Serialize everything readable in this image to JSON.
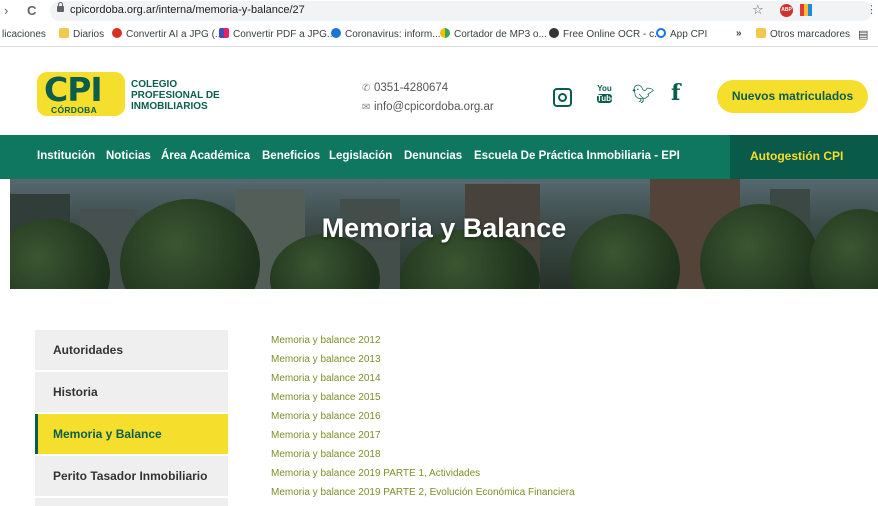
{
  "browser": {
    "url": "cpicordoba.org.ar/interna/memoria-y-balance/27",
    "bookmarks": [
      {
        "label": "licaciones",
        "icon": "none"
      },
      {
        "label": "Diarios",
        "icon": "folder"
      },
      {
        "label": "Convertir AI a JPG (...",
        "icon": "red-circle"
      },
      {
        "label": "Convertir PDF a JPG...",
        "icon": "grid"
      },
      {
        "label": "Coronavirus: inform...",
        "icon": "blue-drop"
      },
      {
        "label": "Cortador de MP3 o...",
        "icon": "multi-dot"
      },
      {
        "label": "Free Online OCR - c...",
        "icon": "dark-circle"
      },
      {
        "label": "App CPI",
        "icon": "ring"
      },
      {
        "label": "Otros marcadores",
        "icon": "folder"
      }
    ],
    "bookmarks_overflow": "»"
  },
  "header": {
    "logo_main": "CPI",
    "logo_city": "CÓRDOBA",
    "org_name_lines": [
      "COLEGIO",
      "PROFESIONAL DE",
      "INMOBILIARIOS"
    ],
    "phone": "0351-4280674",
    "email": "info@cpicordoba.org.ar",
    "cta_label": "Nuevos matriculados",
    "social_icons": [
      "instagram-icon",
      "youtube-icon",
      "twitter-icon",
      "facebook-icon"
    ],
    "youtube_you": "You",
    "youtube_tube": "Tube"
  },
  "nav": {
    "items": [
      "Institución",
      "Noticias",
      "Área Académica",
      "Beneficios",
      "Legislación",
      "Denuncias",
      "Escuela De Práctica Inmobiliaria - EPI"
    ],
    "autogestion": "Autogestión CPI"
  },
  "hero": {
    "title": "Memoria y Balance"
  },
  "sidebar": {
    "items": [
      {
        "label": "Autoridades",
        "active": false
      },
      {
        "label": "Historia",
        "active": false
      },
      {
        "label": "Memoria y Balance",
        "active": true
      },
      {
        "label": "Perito Tasador Inmobiliario",
        "active": false
      }
    ]
  },
  "documents": [
    "Memoria y balance 2012",
    "Memoria y balance 2013",
    "Memoria y balance 2014",
    "Memoria y balance 2015",
    "Memoria y balance 2016",
    "Memoria y balance 2017",
    "Memoria y balance 2018",
    "Memoria y balance 2019 PARTE 1, Actividades",
    "Memoria y balance 2019 PARTE 2, Evolución Económica Financiera"
  ],
  "colors": {
    "brand_green": "#0f7660",
    "brand_dark_green": "#0b5d4e",
    "brand_yellow": "#f5df2c",
    "link_color": "#7b8f2a"
  }
}
